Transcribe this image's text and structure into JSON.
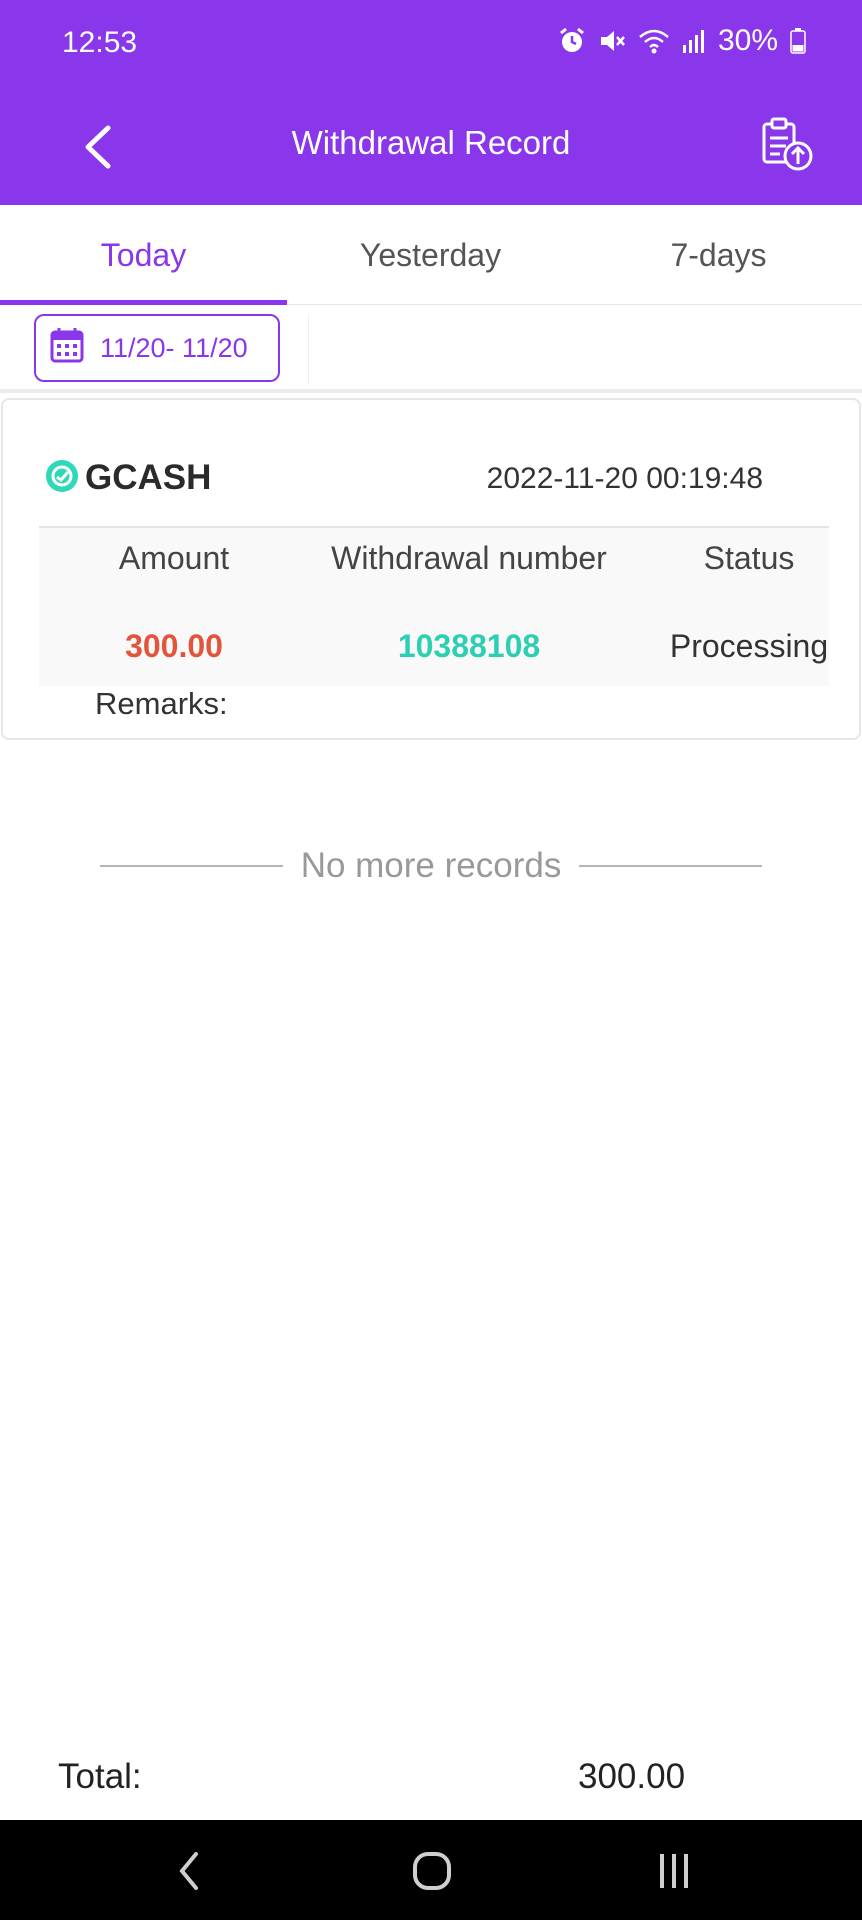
{
  "status_bar": {
    "time": "12:53",
    "battery": "30%",
    "icons": [
      "alarm-icon",
      "mute-icon",
      "wifi-icon",
      "signal-icon",
      "battery-icon"
    ]
  },
  "header": {
    "title": "Withdrawal Record",
    "back_icon": "back-arrow-icon",
    "export_icon": "clipboard-upload-icon"
  },
  "tabs": [
    {
      "label": "Today",
      "active": true
    },
    {
      "label": "Yesterday",
      "active": false
    },
    {
      "label": "7-days",
      "active": false
    }
  ],
  "date_filter": {
    "label": "11/20- 11/20",
    "icon": "calendar-icon"
  },
  "records": [
    {
      "method": "GCASH",
      "method_icon": "gcash-logo-icon",
      "datetime": "2022-11-20 00:19:48",
      "columns": {
        "amount_header": "Amount",
        "number_header": "Withdrawal number",
        "status_header": "Status"
      },
      "amount": "300.00",
      "number": "10388108",
      "status": "Processing",
      "remarks_label": "Remarks:"
    }
  ],
  "no_more_text": "No more records",
  "footer": {
    "total_label": "Total:",
    "total_value": "300.00"
  },
  "colors": {
    "brand": "#8a36ea",
    "amount": "#e2553c",
    "number": "#2ccfb2",
    "gcash": "#2ed8b8"
  },
  "nav": [
    "back-nav-icon",
    "home-nav-icon",
    "recents-nav-icon"
  ]
}
